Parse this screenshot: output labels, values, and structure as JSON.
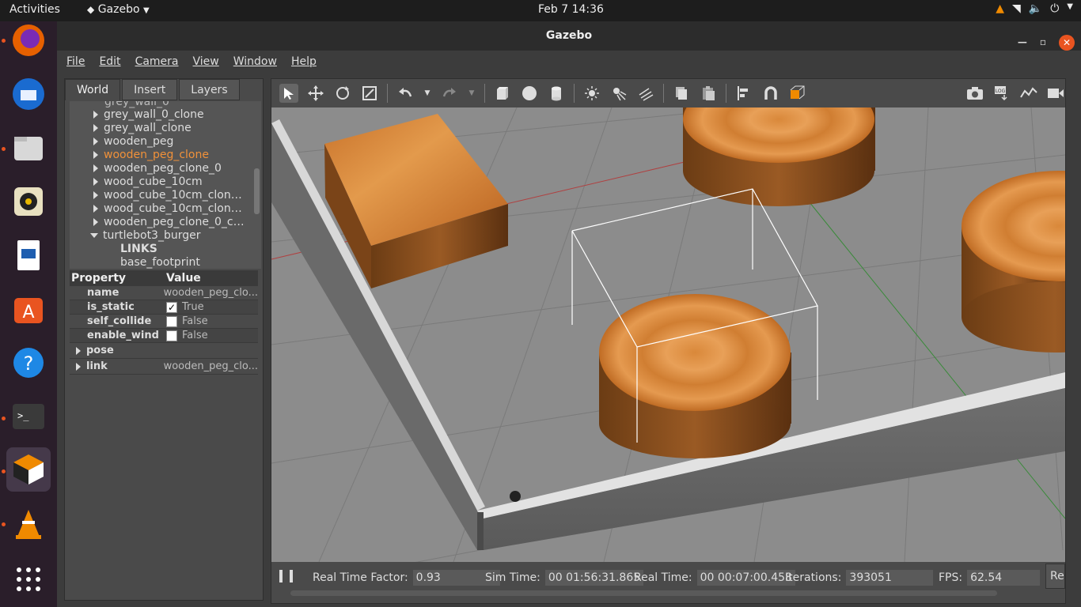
{
  "topbar": {
    "activities": "Activities",
    "app_name": "Gazebo",
    "clock": "Feb 7  14:36"
  },
  "window": {
    "title": "Gazebo"
  },
  "menu": {
    "file": "File",
    "edit": "Edit",
    "camera": "Camera",
    "view": "View",
    "window": "Window",
    "help": "Help"
  },
  "left_tabs": {
    "world": "World",
    "insert": "Insert",
    "layers": "Layers"
  },
  "tree": {
    "items": [
      {
        "label": "grey_wall_0_clone",
        "color": "#dddddd"
      },
      {
        "label": "grey_wall_clone",
        "color": "#dddddd"
      },
      {
        "label": "wooden_peg",
        "color": "#dddddd"
      },
      {
        "label": "wooden_peg_clone",
        "color": "#f0913a"
      },
      {
        "label": "wooden_peg_clone_0",
        "color": "#dddddd"
      },
      {
        "label": "wood_cube_10cm",
        "color": "#dddddd"
      },
      {
        "label": "wood_cube_10cm_clon…",
        "color": "#dddddd"
      },
      {
        "label": "wood_cube_10cm_clon…",
        "color": "#dddddd"
      },
      {
        "label": "wooden_peg_clone_0_c…",
        "color": "#dddddd"
      },
      {
        "label": "turtlebot3_burger",
        "color": "#dddddd"
      }
    ],
    "links_label": "LINKS",
    "base_footprint": "base_footprint"
  },
  "properties": {
    "header_property": "Property",
    "header_value": "Value",
    "rows": [
      {
        "name": "name",
        "value": "wooden_peg_clo..."
      },
      {
        "name": "is_static",
        "value": "True",
        "checked": true
      },
      {
        "name": "self_collide",
        "value": "False",
        "checked": false
      },
      {
        "name": "enable_wind",
        "value": "False",
        "checked": false
      },
      {
        "name": "pose",
        "value": ""
      },
      {
        "name": "link",
        "value": "wooden_peg_clo..."
      }
    ]
  },
  "status": {
    "rtf_label": "Real Time Factor:",
    "rtf_value": "0.93",
    "sim_label": "Sim Time:",
    "sim_value": "00 01:56:31.865",
    "real_label": "Real Time:",
    "real_value": "00 00:07:00.458",
    "iter_label": "Iterations:",
    "iter_value": "393051",
    "fps_label": "FPS:",
    "fps_value": "62.54",
    "reset_label": "Re"
  }
}
